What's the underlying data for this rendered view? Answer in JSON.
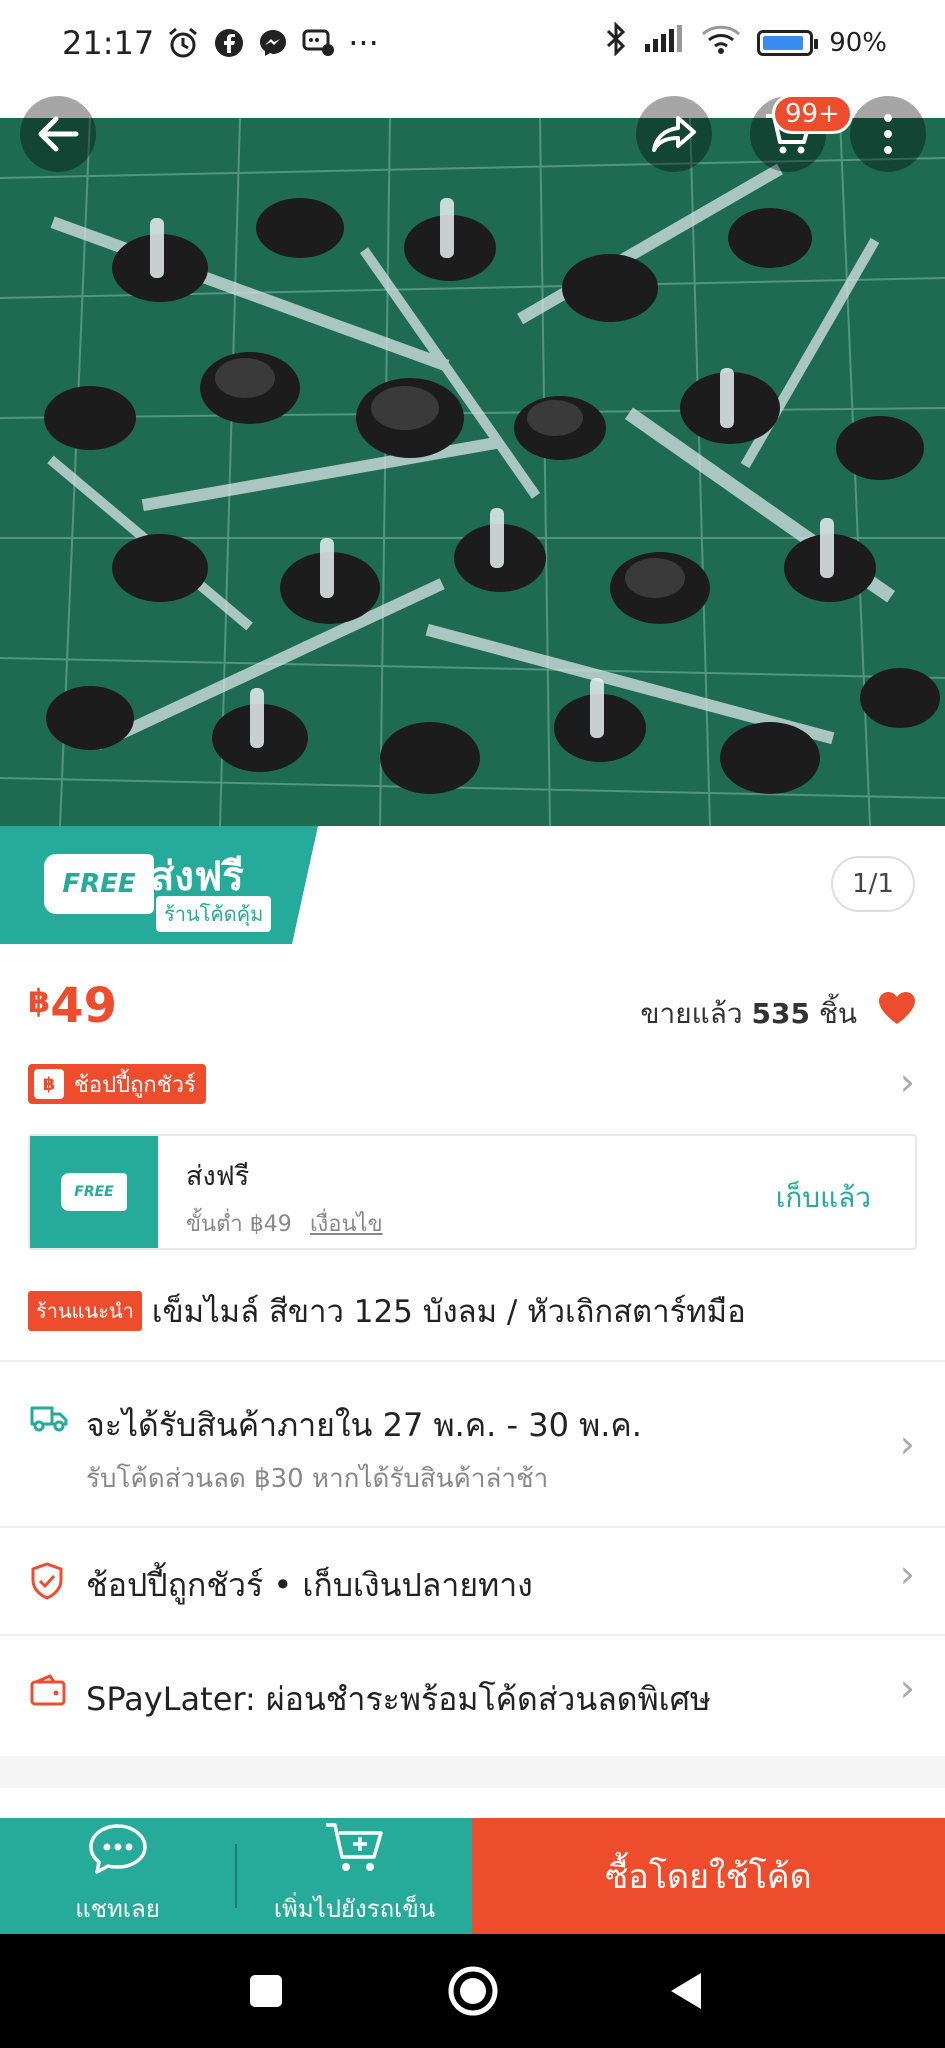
{
  "status_bar": {
    "time": "21:17",
    "icons": [
      "alarm-icon",
      "facebook-icon",
      "messenger-icon",
      "chat-bubble-icon",
      "more-dots-icon",
      "bluetooth-icon",
      "signal-icon",
      "wifi-icon",
      "battery-icon"
    ],
    "battery": "90%",
    "battery_level": 0.9,
    "more": "···"
  },
  "header": {
    "cart_badge": "99+"
  },
  "gallery": {
    "page_indicator": "1/1"
  },
  "free_ship_banner": {
    "truck_text": "FREE",
    "main": "ส่งฟรี",
    "sub": "ร้านโค้ดคุ้ม"
  },
  "product": {
    "currency": "฿",
    "price": "49",
    "sold_prefix": "ขายแล้ว",
    "sold_count": "535",
    "sold_unit": "ชิ้น",
    "guarantee_icon_text": "฿",
    "guarantee_label": "ช้อปปี้ถูกชัวร์",
    "title_tag": "ร้านแนะนำ",
    "title": "เข็มไมล์ สีขาว 125 บังลม / หัวเถิกสตาร์ทมือ"
  },
  "voucher": {
    "truck_text": "FREE",
    "title": "ส่งฟรี",
    "min_spend": "ขั้นต่ำ ฿49",
    "conditions": "เงื่อนไข",
    "claim_status": "เก็บแล้ว"
  },
  "info_rows": {
    "delivery_title": "จะได้รับสินค้าภายใน 27 พ.ค. - 30 พ.ค.",
    "delivery_sub": "รับโค้ดส่วนลด ฿30 หากได้รับสินค้าล่าช้า",
    "guarantee_text": "ช้อปปี้ถูกชัวร์ • เก็บเงินปลายทาง",
    "spaylater_text": "SPayLater: ผ่อนชำระพร้อมโค้ดส่วนลดพิเศษ"
  },
  "actions": {
    "chat": "แชทเลย",
    "add_to_cart": "เพิ่มไปยังรถเข็น",
    "buy": "ซื้อโดยใช้โค้ด"
  },
  "colors": {
    "brand_orange": "#ee4d2d",
    "teal": "#26aa99"
  }
}
